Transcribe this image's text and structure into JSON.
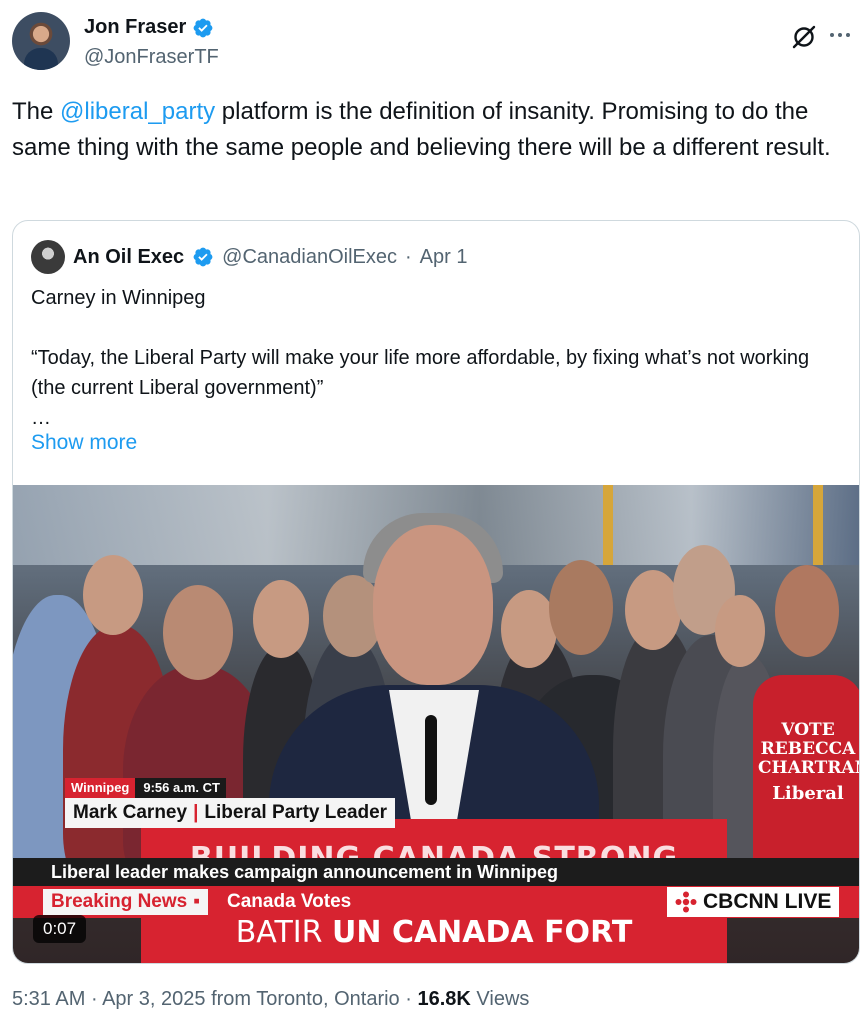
{
  "author": {
    "display_name": "Jon Fraser",
    "handle": "@JonFraserTF",
    "verified": true
  },
  "tweet": {
    "text_before": "The ",
    "mention": "@liberal_party",
    "text_after": " platform is the definition of insanity. Promising to do the same thing with the same people and believing there will be a different result."
  },
  "quoted": {
    "display_name": "An Oil Exec",
    "handle": "@CanadianOilExec",
    "date": "Apr 1",
    "separator": "·",
    "lines": [
      "Carney in Winnipeg",
      "",
      "“Today, the Liberal Party will make your life more affordable, by fixing what’s not working (the current Liberal government)”",
      "…"
    ],
    "show_more": "Show more"
  },
  "video": {
    "duration": "0:07",
    "location": "Winnipeg",
    "time_ct": "9:56 a.m. CT",
    "name": "Mark Carney",
    "name_sep": "|",
    "title": "Liberal Party Leader",
    "podium_text": "BUILDING CANADA STRONG",
    "strip_text": "Liberal leader makes campaign announcement in Winnipeg",
    "breaking": "Breaking News",
    "section": "Canada Votes",
    "network": "CBCNN LIVE",
    "batir_light": "BATIR ",
    "batir_bold": "UN CANADA FORT",
    "shirt_lines": [
      "VOTE",
      "REBECCA",
      "CHARTRAN",
      "Liberal"
    ]
  },
  "footer": {
    "time": "5:31 AM",
    "date": "Apr 3, 2025",
    "from": "from Toronto, Ontario",
    "dot": "·",
    "views_count": "16.8K",
    "views_label": "Views"
  },
  "colors": {
    "link": "#1d9bf0",
    "secondary_text": "#536471",
    "cbc_red": "#d72330"
  },
  "icons": [
    "verified-badge-icon",
    "grok-icon",
    "more-icon",
    "cbc-gem-icon"
  ]
}
